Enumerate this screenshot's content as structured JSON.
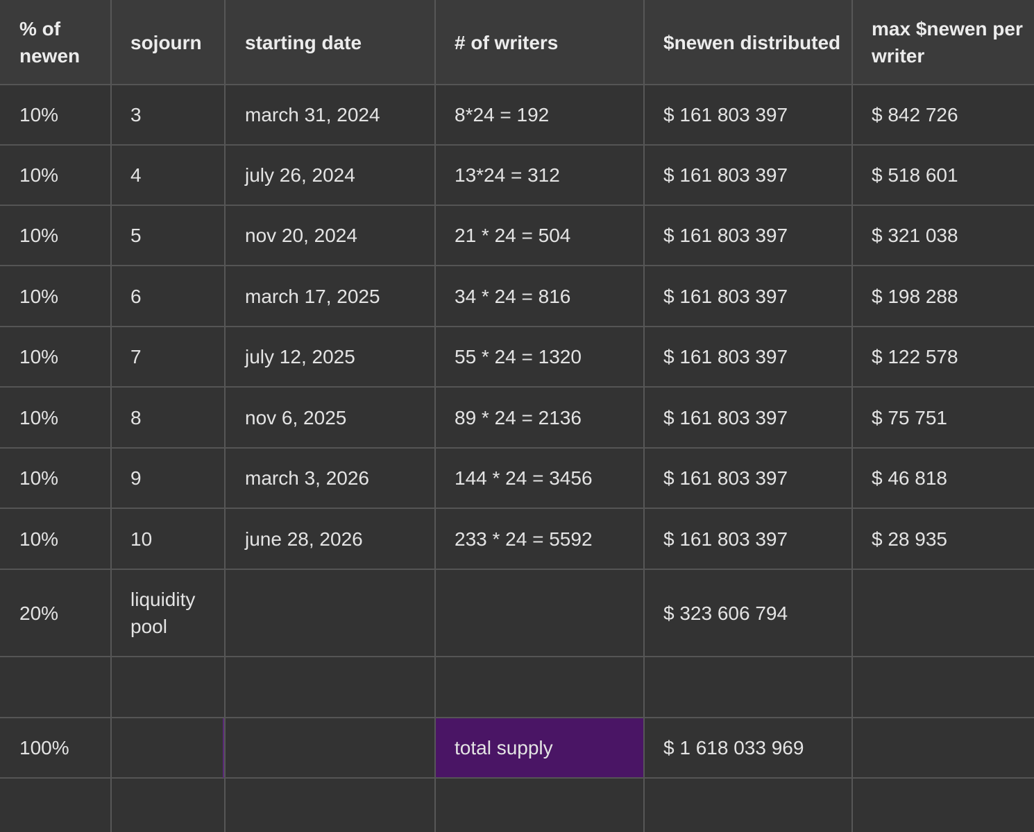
{
  "headers": [
    "% of newen",
    "sojourn",
    "starting date",
    "# of writers",
    "$newen distributed",
    "max $newen per writer"
  ],
  "rows": [
    [
      "10%",
      "3",
      "march 31, 2024",
      "8*24 = 192",
      "$ 161 803 397",
      "$ 842 726"
    ],
    [
      "10%",
      "4",
      "july 26, 2024",
      "13*24 = 312",
      "$ 161 803 397",
      "$ 518 601"
    ],
    [
      "10%",
      "5",
      "nov 20, 2024",
      "21 * 24 = 504",
      "$ 161 803 397",
      "$ 321 038"
    ],
    [
      "10%",
      "6",
      "march 17, 2025",
      "34 * 24 = 816",
      "$ 161 803 397",
      "$ 198 288"
    ],
    [
      "10%",
      "7",
      "july 12, 2025",
      "55 * 24 = 1320",
      "$ 161 803 397",
      "$ 122 578"
    ],
    [
      "10%",
      "8",
      "nov 6, 2025",
      "89 * 24 = 2136",
      "$ 161 803 397",
      "$ 75 751"
    ],
    [
      "10%",
      "9",
      "march 3, 2026",
      "144 * 24 = 3456",
      "$ 161 803 397",
      "$ 46 818"
    ],
    [
      "10%",
      "10",
      "june 28, 2026",
      "233 * 24 = 5592",
      "$ 161 803 397",
      "$ 28 935"
    ],
    [
      "20%",
      "liquidity pool",
      "",
      "",
      "$ 323 606 794",
      ""
    ],
    [
      "",
      "",
      "",
      "",
      "",
      ""
    ],
    [
      "100%",
      "",
      "",
      "total supply",
      "$ 1 618 033 969",
      ""
    ],
    [
      "",
      "",
      "",
      "",
      "",
      ""
    ]
  ],
  "colors": {
    "background": "#333333",
    "header_background": "#3b3b3b",
    "grid_line": "#575757",
    "text": "#e4e4e4",
    "total_supply_highlight": "#4a1565"
  }
}
